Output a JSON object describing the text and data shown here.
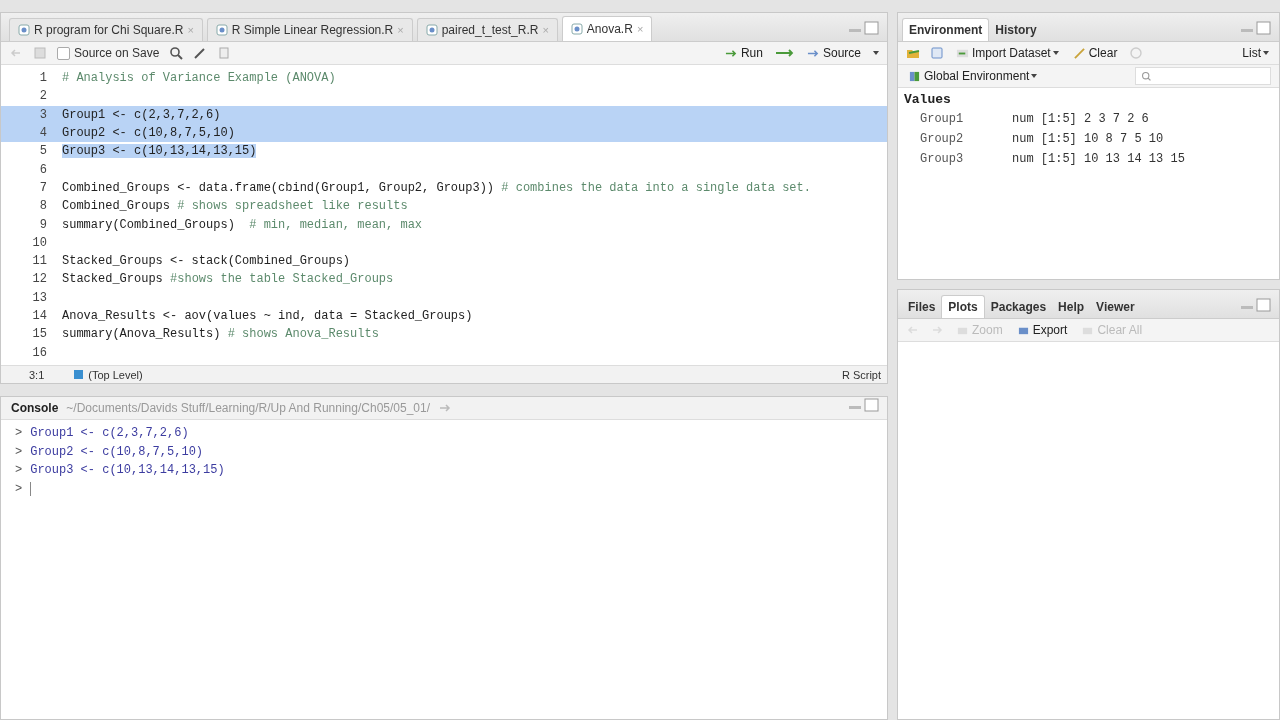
{
  "editor": {
    "tabs": [
      {
        "label": "R program for Chi Square.R",
        "close": "×",
        "selected": false
      },
      {
        "label": "R Simple Linear Regression.R",
        "close": "×",
        "selected": false
      },
      {
        "label": "paired_t_test_R.R",
        "close": "×",
        "selected": false
      },
      {
        "label": "Anova.R",
        "close": "×",
        "selected": true
      }
    ],
    "toolbar": {
      "source_on_save": {
        "label": "Source on Save",
        "checked": false
      },
      "run": "Run",
      "source": "Source"
    },
    "lines": [
      {
        "number": "1",
        "comment": "# Analysis of Variance Example (ANOVA)",
        "selected": false
      },
      {
        "number": "2",
        "selected": false
      },
      {
        "number": "3",
        "code": "Group1 <- c(2,3,7,2,6)",
        "selected": true,
        "to_line_end": true
      },
      {
        "number": "4",
        "code": "Group2 <- c(10,8,7,5,10)",
        "selected": true,
        "to_line_end": true
      },
      {
        "number": "5",
        "code": "Group3 <- c(10,13,14,13,15)",
        "selected": true,
        "to_line_end": false
      },
      {
        "number": "6",
        "selected": false
      },
      {
        "number": "7",
        "code": "Combined_Groups <- data.frame(cbind(Group1, Group2, Group3))",
        "comment": " # combines the data into a single data set.",
        "selected": false
      },
      {
        "number": "8",
        "code": "Combined_Groups",
        "comment": " # shows spreadsheet like results",
        "selected": false
      },
      {
        "number": "9",
        "code": "summary(Combined_Groups)",
        "comment": "  # min, median, mean, max",
        "selected": false
      },
      {
        "number": "10",
        "selected": false
      },
      {
        "number": "11",
        "code": "Stacked_Groups <- stack(Combined_Groups)",
        "selected": false
      },
      {
        "number": "12",
        "code": "Stacked_Groups",
        "comment": " #shows the table Stacked_Groups",
        "selected": false
      },
      {
        "number": "13",
        "selected": false
      },
      {
        "number": "14",
        "code": "Anova_Results <- aov(values ~ ind, data = Stacked_Groups)",
        "selected": false
      },
      {
        "number": "15",
        "code": "summary(Anova_Results)",
        "comment": " # shows Anova_Results",
        "selected": false
      },
      {
        "number": "16",
        "selected": false
      }
    ],
    "status": {
      "position": "3:1",
      "scope": "(Top Level)",
      "file_type": "R Script"
    }
  },
  "console": {
    "title": "Console",
    "path": "~/Documents/Davids Stuff/Learning/R/Up And Running/Ch05/05_01/",
    "lines": [
      {
        "prompt": ">",
        "command": "Group1 <- c(2,3,7,2,6)"
      },
      {
        "prompt": ">",
        "command": "Group2 <- c(10,8,7,5,10)"
      },
      {
        "prompt": ">",
        "command": "Group3 <- c(10,13,14,13,15)"
      },
      {
        "prompt": ">"
      }
    ]
  },
  "environment": {
    "tabs": [
      {
        "label": "Environment",
        "selected": true
      },
      {
        "label": "History",
        "selected": false
      }
    ],
    "toolbar": {
      "import": "Import Dataset",
      "clear": "Clear",
      "view": "List"
    },
    "scope": "Global Environment",
    "section": "Values",
    "rows": [
      {
        "name": "Group1",
        "value": "num [1:5] 2 3 7 2 6"
      },
      {
        "name": "Group2",
        "value": "num [1:5] 10 8 7 5 10"
      },
      {
        "name": "Group3",
        "value": "num [1:5] 10 13 14 13 15"
      }
    ]
  },
  "files": {
    "tabs": [
      {
        "label": "Files",
        "selected": false
      },
      {
        "label": "Plots",
        "selected": true
      },
      {
        "label": "Packages",
        "selected": false
      },
      {
        "label": "Help",
        "selected": false
      },
      {
        "label": "Viewer",
        "selected": false
      }
    ],
    "toolbar": [
      {
        "label": "Zoom",
        "disabled": true
      },
      {
        "label": "Export",
        "disabled": false
      },
      {
        "label": "Clear All",
        "disabled": true
      }
    ]
  }
}
